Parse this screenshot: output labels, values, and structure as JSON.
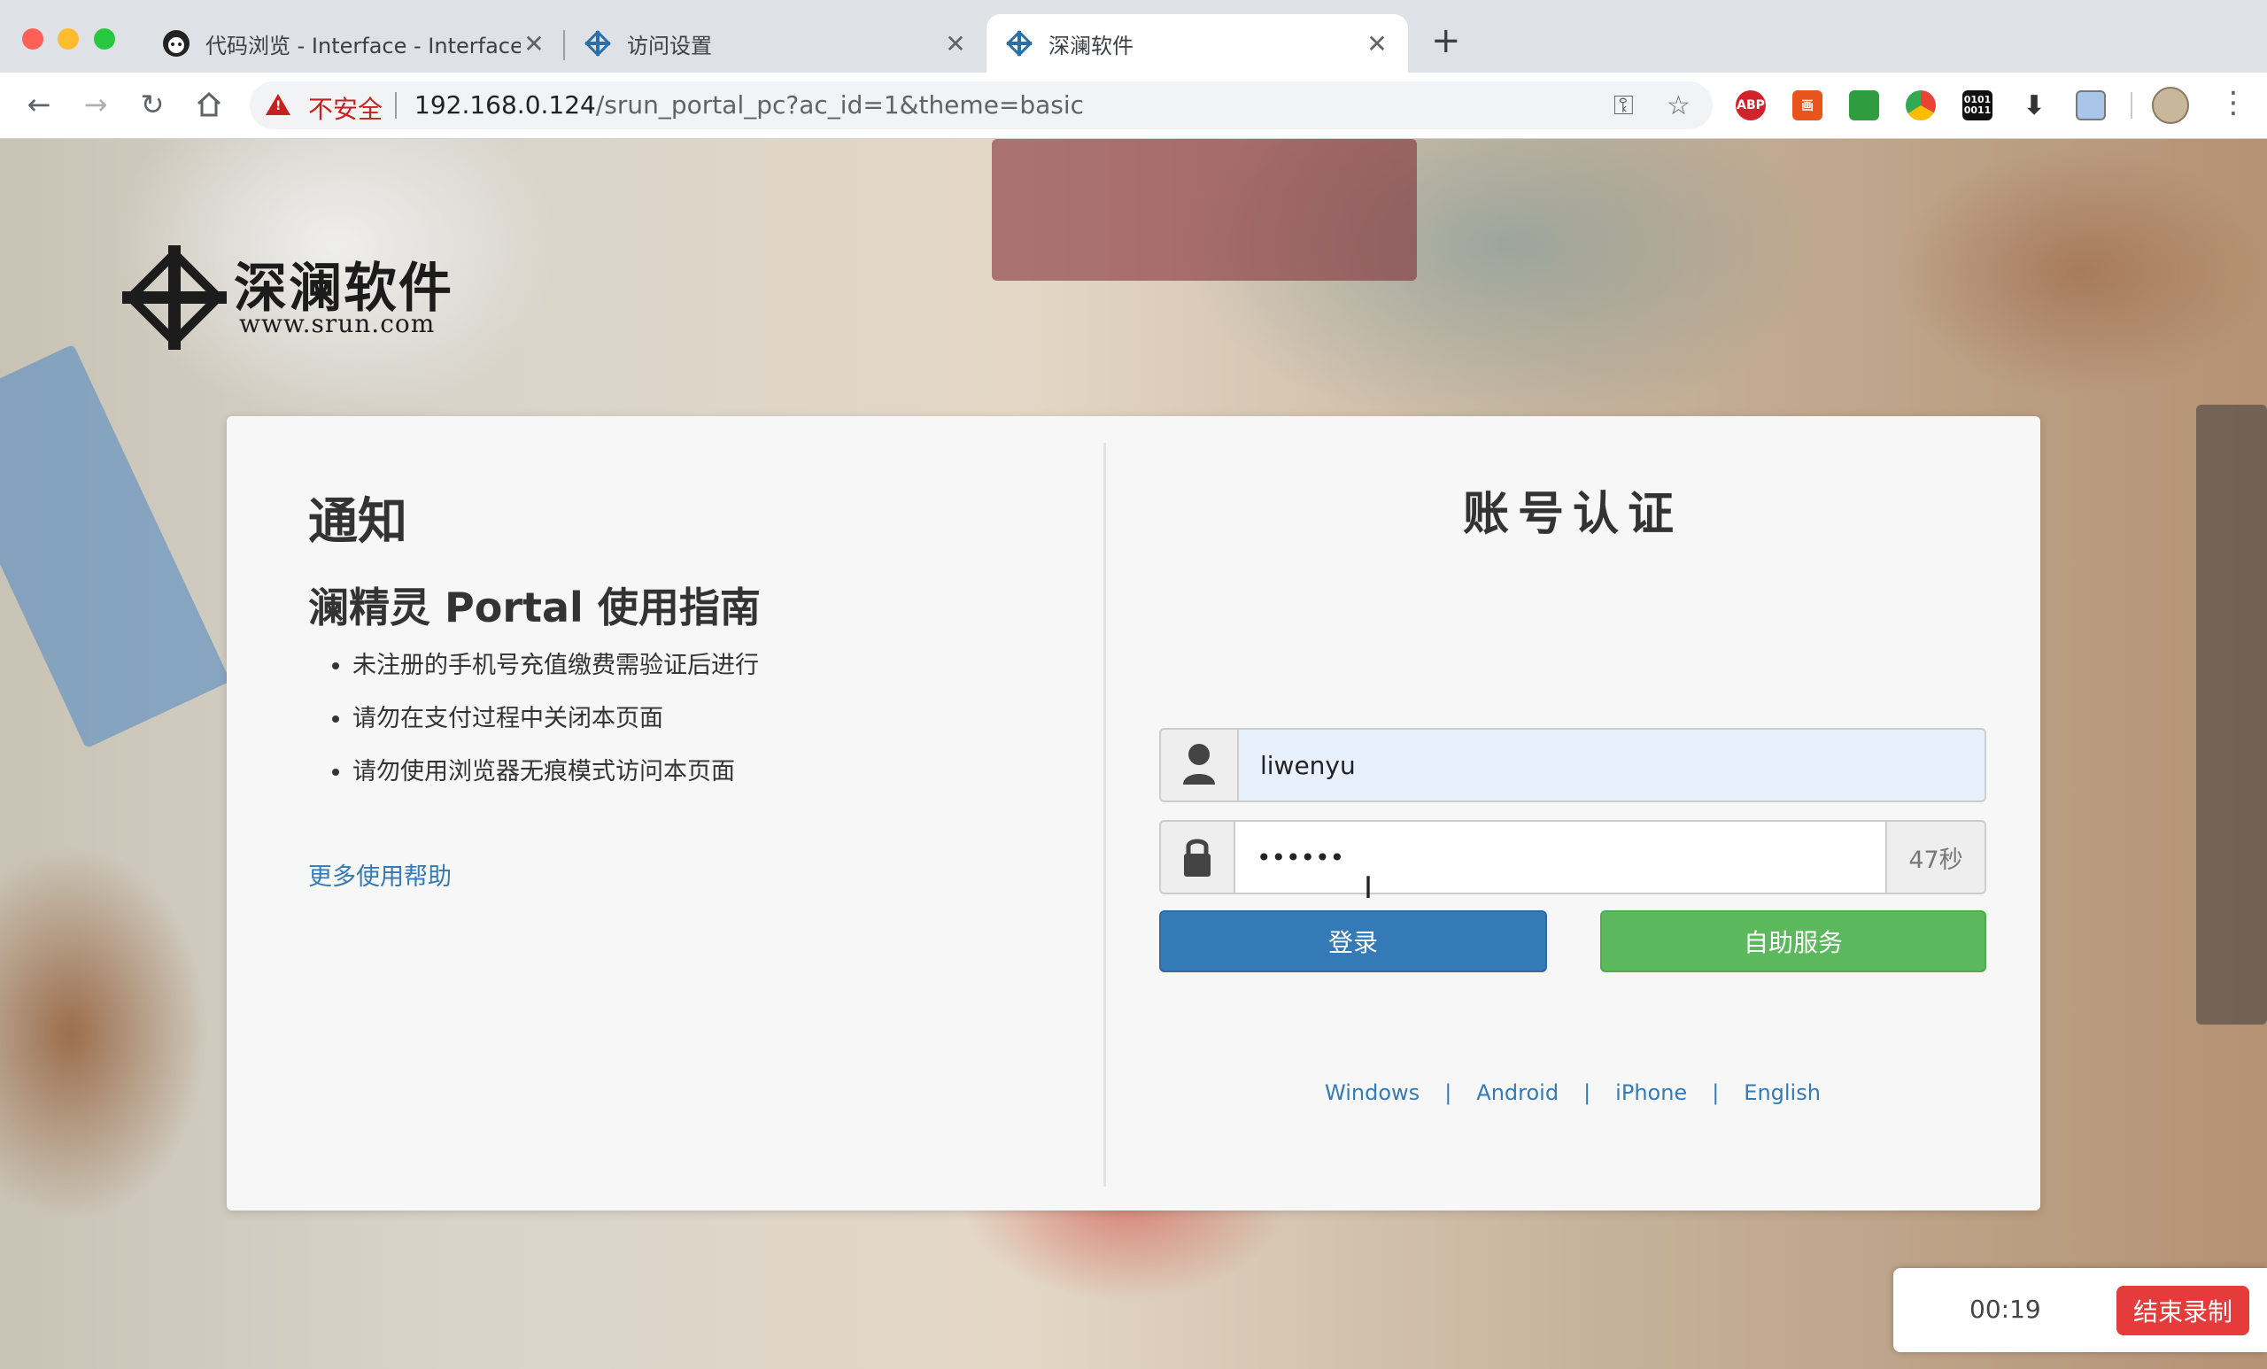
{
  "browser": {
    "tabs": [
      {
        "title": "代码浏览 - Interface - Interface",
        "close": "✕",
        "active": false
      },
      {
        "title": "访问设置",
        "close": "✕",
        "active": false
      },
      {
        "title": "深澜软件",
        "close": "✕",
        "active": true
      }
    ],
    "new_tab": "+",
    "security_label": "不安全",
    "url_host": "192.168.0.124",
    "url_path": "/srun_portal_pc?ac_id=1&theme=basic",
    "extensions": [
      "ABP",
      "画",
      "",
      "",
      "0101 0011"
    ]
  },
  "logo": {
    "title": "深澜软件",
    "subtitle": "www.srun.com"
  },
  "notice": {
    "heading": "通知",
    "guide_title": "澜精灵 Portal 使用指南",
    "items": [
      "未注册的手机号充值缴费需验证后进行",
      "请勿在支付过程中关闭本页面",
      "请勿使用浏览器无痕模式访问本页面"
    ],
    "more_help": "更多使用帮助"
  },
  "auth": {
    "heading": "账号认证",
    "username": "liwenyu",
    "password_mask": "••••••",
    "countdown": "47秒",
    "login_button": "登录",
    "self_service_button": "自助服务",
    "links": [
      "Windows",
      "Android",
      "iPhone",
      "English"
    ],
    "link_separator": "|"
  },
  "recorder": {
    "time": "00:19",
    "stop_button": "结束录制"
  }
}
